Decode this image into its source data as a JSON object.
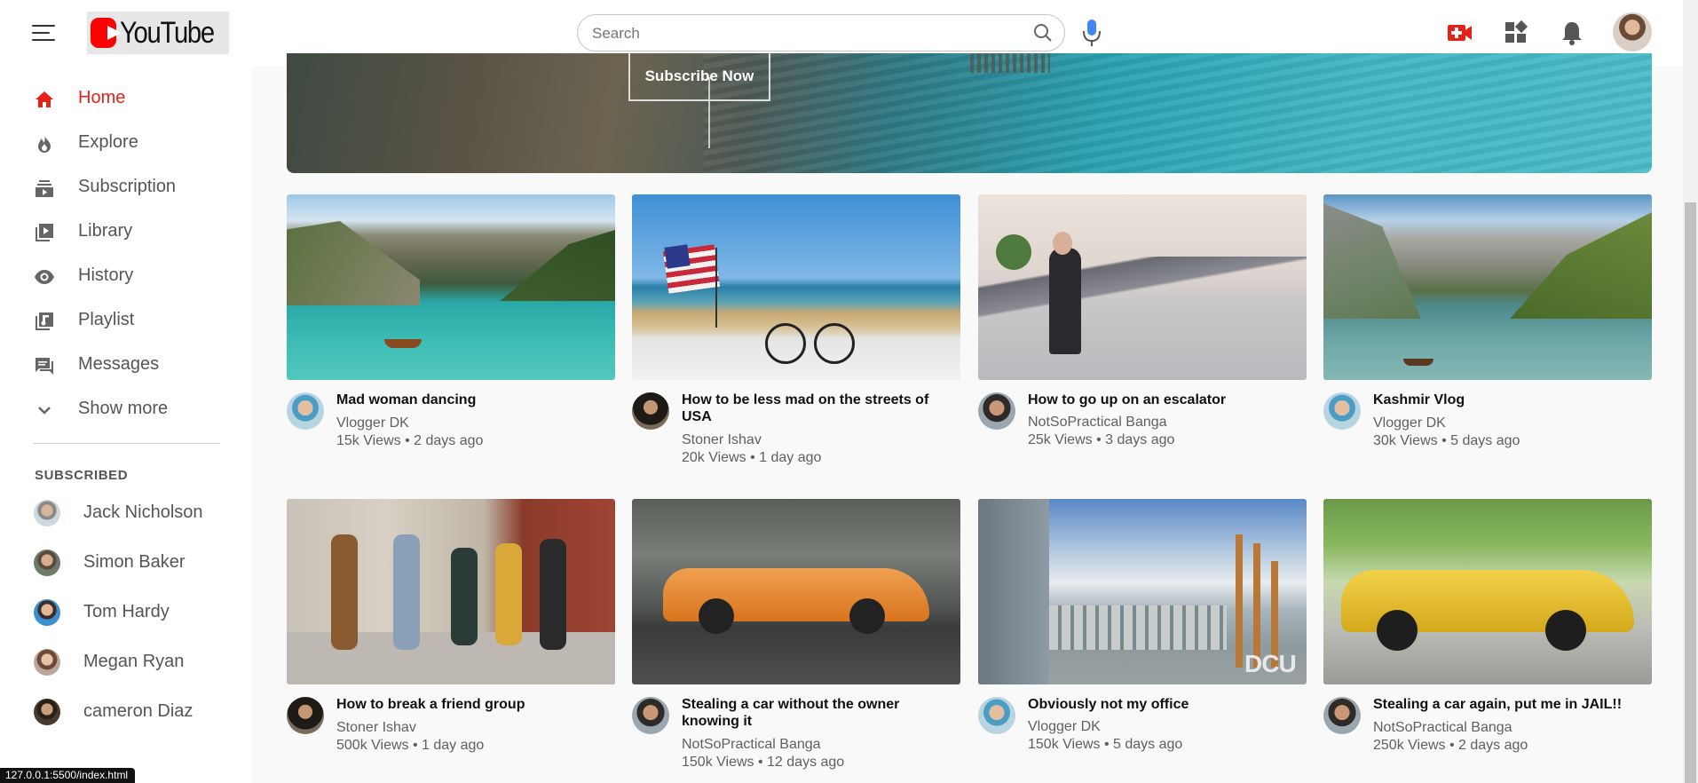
{
  "header": {
    "logo_text": "YouTube",
    "search_placeholder": "Search"
  },
  "sidebar": {
    "items": [
      {
        "label": "Home",
        "icon": "home-icon",
        "active": true
      },
      {
        "label": "Explore",
        "icon": "explore-icon"
      },
      {
        "label": "Subscription",
        "icon": "subscription-icon"
      },
      {
        "label": "Library",
        "icon": "library-icon"
      },
      {
        "label": "History",
        "icon": "history-icon"
      },
      {
        "label": "Playlist",
        "icon": "playlist-icon"
      },
      {
        "label": "Messages",
        "icon": "messages-icon"
      },
      {
        "label": "Show more",
        "icon": "chevron-down-icon"
      }
    ],
    "subscribed_title": "SUBSCRIBED",
    "subscribed": [
      {
        "name": "Jack Nicholson"
      },
      {
        "name": "Simon Baker"
      },
      {
        "name": "Tom Hardy"
      },
      {
        "name": "Megan Ryan"
      },
      {
        "name": "cameron Diaz"
      }
    ]
  },
  "banner": {
    "button_label": "Subscribe Now"
  },
  "videos": [
    {
      "title": "Mad woman dancing",
      "channel": "Vlogger DK",
      "meta": "15k Views • 2 days ago"
    },
    {
      "title": "How to be less mad on the streets of USA",
      "channel": "Stoner Ishav",
      "meta": "20k Views • 1 day ago"
    },
    {
      "title": "How to go up on an escalator",
      "channel": "NotSoPractical Banga",
      "meta": "25k Views • 3 days ago"
    },
    {
      "title": "Kashmir Vlog",
      "channel": "Vlogger DK",
      "meta": "30k Views • 5 days ago"
    },
    {
      "title": "How to break a friend group",
      "channel": "Stoner Ishav",
      "meta": "500k Views • 1 day ago"
    },
    {
      "title": "Stealing a car without the owner knowing it",
      "channel": "NotSoPractical Banga",
      "meta": "150k Views • 12 days ago"
    },
    {
      "title": "Obviously not my office",
      "channel": "Vlogger DK",
      "meta": "150k Views • 5 days ago"
    },
    {
      "title": "Stealing a car again, put me in JAIL!!",
      "channel": "NotSoPractical Banga",
      "meta": "250k Views • 2 days ago"
    }
  ],
  "thumbnail_overlay": "DCU",
  "status_bar": {
    "url": "127.0.0.1:5500/index.html"
  },
  "colors": {
    "accent": "#e62117",
    "youtube_red": "#ff0000"
  }
}
